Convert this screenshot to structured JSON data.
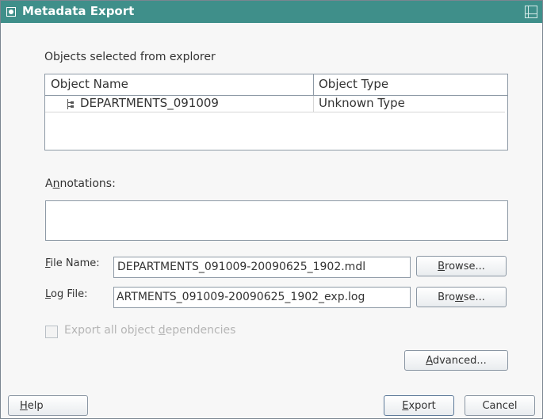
{
  "window": {
    "title": "Metadata Export"
  },
  "objects": {
    "label": "Objects selected from explorer",
    "columns": [
      "Object Name",
      "Object Type"
    ],
    "rows": [
      {
        "name": "DEPARTMENTS_091009",
        "type": "Unknown Type"
      }
    ]
  },
  "annotations": {
    "label_pre": "A",
    "label_u": "n",
    "label_post": "notations:",
    "value": ""
  },
  "file_name": {
    "label_u": "F",
    "label_post": "ile Name:",
    "value": "DEPARTMENTS_091009-20090625_1902.mdl"
  },
  "log_file": {
    "label_u": "L",
    "label_post": "og File:",
    "value": "ARTMENTS_091009-20090625_1902_exp.log"
  },
  "browse1": {
    "pre": "",
    "u": "B",
    "post": "rowse..."
  },
  "browse2": {
    "pre": "Bro",
    "u": "w",
    "post": "se..."
  },
  "dependencies": {
    "pre": "Export all object ",
    "u": "d",
    "post": "ependencies",
    "checked": false,
    "enabled": false
  },
  "advanced": {
    "u": "A",
    "post": "dvanced..."
  },
  "help": {
    "u": "H",
    "post": "elp"
  },
  "export": {
    "u": "E",
    "post": "xport"
  },
  "cancel": {
    "label": "Cancel"
  }
}
